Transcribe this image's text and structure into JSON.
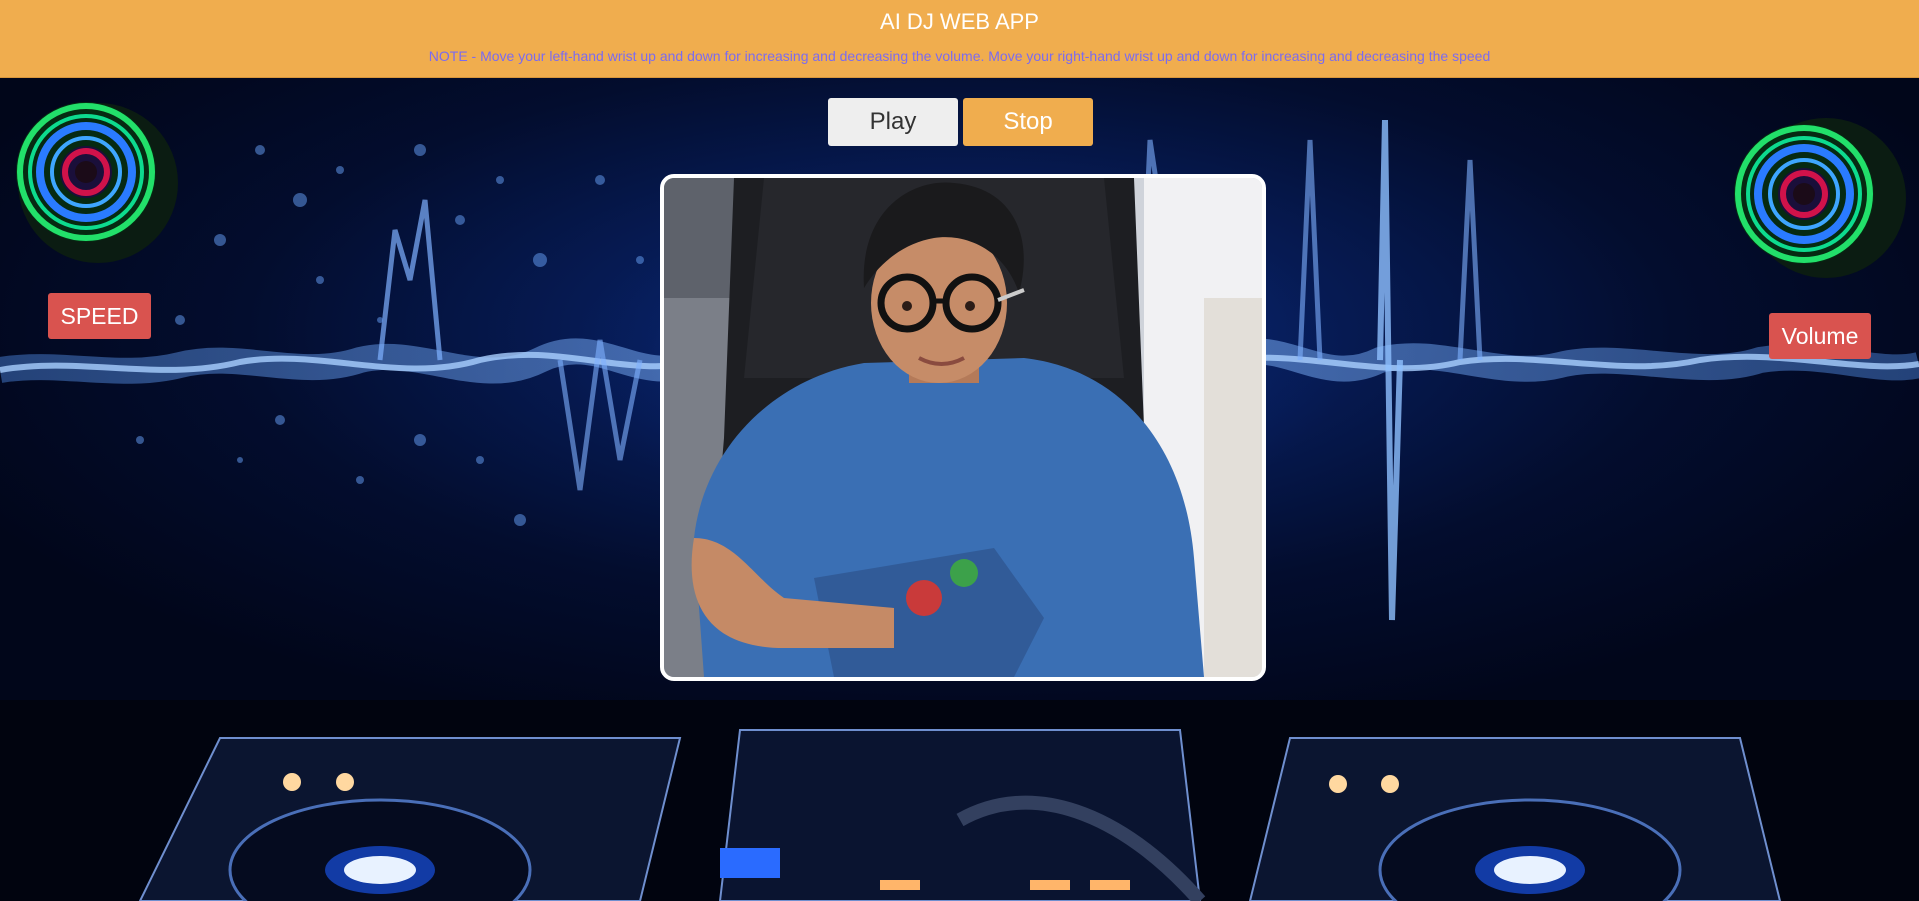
{
  "header": {
    "title": "AI DJ WEB APP",
    "note": "NOTE - Move your left-hand wrist up and down for increasing and decreasing the volume. Move your right-hand wrist up and down for increasing and decreasing the speed"
  },
  "controls": {
    "play_label": "Play",
    "stop_label": "Stop"
  },
  "indicators": {
    "speed_label": "SPEED",
    "volume_label": "Volume"
  },
  "icons": {
    "left_speaker": "speaker-icon",
    "right_speaker": "speaker-icon"
  },
  "colors": {
    "header_bg": "#f0ad4e",
    "note_text": "#7b6bf0",
    "stop_button": "#f0ad4e",
    "indicator_bg": "#d9534f",
    "speaker_ring_green": "#22e06a",
    "speaker_ring_blue": "#2a7bff",
    "speaker_core_red": "#d0124a"
  }
}
